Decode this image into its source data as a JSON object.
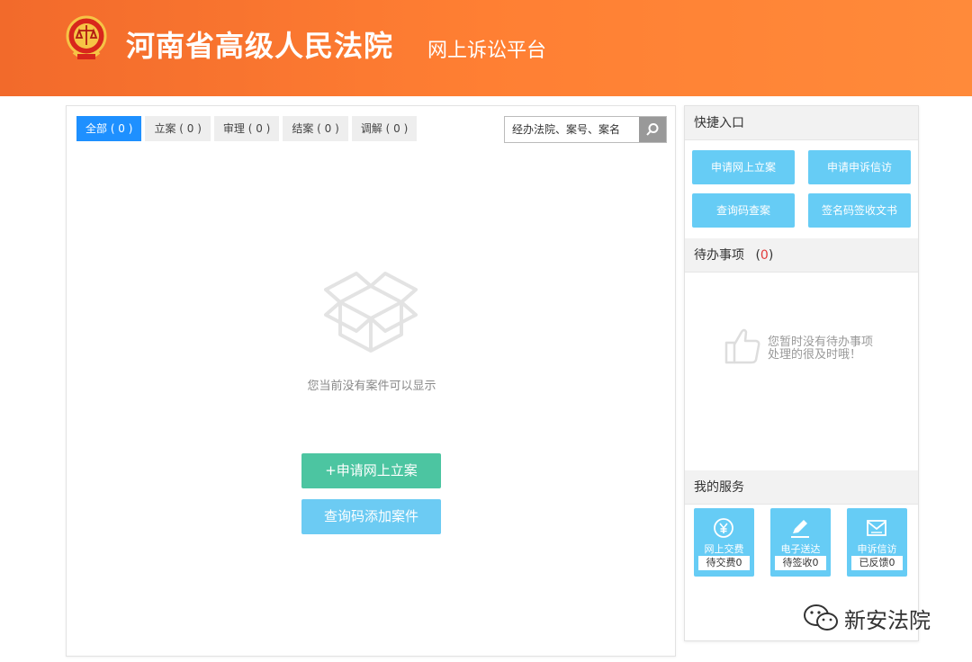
{
  "header": {
    "court_name": "河南省高级人民法院",
    "platform_name": "网上诉讼平台",
    "emblem_icon": "court-emblem-icon"
  },
  "main": {
    "tabs": [
      {
        "label": "全部 ( 0 )",
        "active": true
      },
      {
        "label": "立案 ( 0 )",
        "active": false
      },
      {
        "label": "审理 ( 0 )",
        "active": false
      },
      {
        "label": "结案 ( 0 )",
        "active": false
      },
      {
        "label": "调解 ( 0 )",
        "active": false
      }
    ],
    "search": {
      "placeholder": "经办法院、案号、案名",
      "button_icon": "search-icon"
    },
    "empty_icon": "empty-box-icon",
    "empty_text": "您当前没有案件可以显示",
    "apply_button": "+申请网上立案",
    "query_button": "查询码添加案件"
  },
  "quick": {
    "title": "快捷入口",
    "buttons": [
      "申请网上立案",
      "申请申诉信访",
      "查询码查案",
      "签名码签收文书"
    ]
  },
  "todo": {
    "title": "待办事项",
    "count_open": "(",
    "count": "0",
    "count_close": ")",
    "empty_icon": "thumbs-up-icon",
    "empty_line1": "您暂时没有待办事项",
    "empty_line2": "处理的很及时哦！"
  },
  "services": {
    "title": "我的服务",
    "items": [
      {
        "label": "网上交费",
        "status": "待交费0",
        "icon": "yen-icon"
      },
      {
        "label": "电子送达",
        "status": "待签收0",
        "icon": "pen-icon"
      },
      {
        "label": "申诉信访",
        "status": "已反馈0",
        "icon": "envelope-icon"
      }
    ]
  },
  "watermark": {
    "text": "新安法院",
    "icon": "wechat-icon"
  },
  "colors": {
    "header": "#ff7f33",
    "tab_active": "#1e90ff",
    "apply_button": "#4cc5a1",
    "light_blue": "#66ccf5",
    "todo_count": "#e23b3b"
  }
}
